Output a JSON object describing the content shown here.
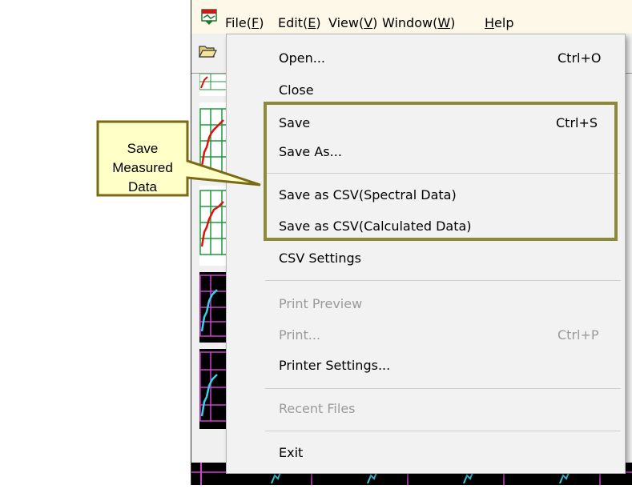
{
  "menubar": {
    "items": [
      {
        "label": "File(",
        "mnemonic": "F",
        "tail": ")"
      },
      {
        "label": "Edit(",
        "mnemonic": "E",
        "tail": ")"
      },
      {
        "label": "View(",
        "mnemonic": "V",
        "tail": ")"
      },
      {
        "label": "Window(",
        "mnemonic": "W",
        "tail": ")"
      },
      {
        "label": "",
        "mnemonic": "H",
        "tail": "elp"
      }
    ]
  },
  "file_menu": {
    "open": {
      "label": "Open...",
      "shortcut": "Ctrl+O"
    },
    "close": {
      "label": "Close"
    },
    "save": {
      "label": "Save",
      "shortcut": "Ctrl+S"
    },
    "save_as": {
      "label": "Save As..."
    },
    "save_csv_spectral": {
      "label": "Save as CSV(Spectral Data)"
    },
    "save_csv_calculated": {
      "label": "Save as CSV(Calculated Data)"
    },
    "csv_settings": {
      "label": "CSV Settings"
    },
    "print_preview": {
      "label": "Print Preview"
    },
    "print": {
      "label": "Print...",
      "shortcut": "Ctrl+P"
    },
    "printer_settings": {
      "label": "Printer Settings..."
    },
    "recent_files": {
      "label": "Recent Files"
    },
    "exit": {
      "label": "Exit"
    }
  },
  "callout": {
    "line1": "Save Measured",
    "line2": "Data"
  },
  "colors": {
    "highlight_border": "#8c8a3a",
    "callout_fill": "#ffffc8",
    "callout_border": "#7a6a14",
    "thumb_green_grid": "#1a9b3a",
    "thumb_red_trace": "#e01010",
    "thumb_magenta_grid": "#d040d0",
    "thumb_cyan_trace": "#3ad0e8"
  },
  "icons": {
    "app": "dok-app-icon",
    "open_toolbar": "folder-open-icon"
  }
}
